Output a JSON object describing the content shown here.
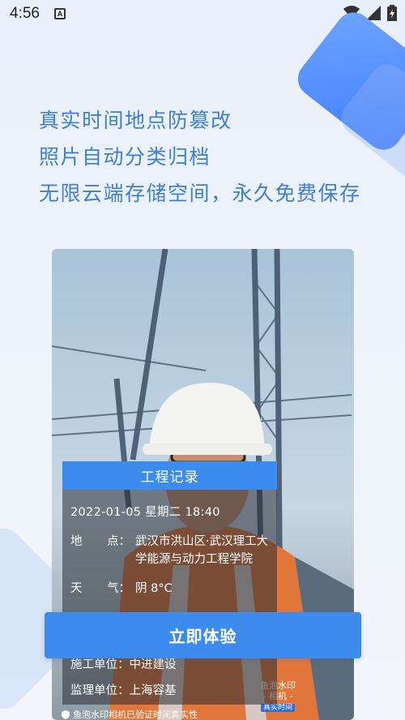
{
  "status_bar": {
    "time": "4:56",
    "app_icon_letter": "A"
  },
  "headline": {
    "line1": "真实时间地点防篡改",
    "line2": "照片自动分类归档",
    "line3": "无限云端存储空间，永久免费保存"
  },
  "record": {
    "title": "工程记录",
    "datetime": "2022-01-05 星期二 18:40",
    "location_label_a": "地",
    "location_label_b": "点：",
    "location_value": "武汉市洪山区·武汉理工大学能源与动力工程学院",
    "weather_label_a": "天",
    "weather_label_b": "气：",
    "weather_value": "阴 8°C",
    "construction_label": "施工单位：",
    "construction_value": "中进建设",
    "supervision_label": "监理单位：",
    "supervision_value": "上海容基"
  },
  "watermark": {
    "brand_line1": "鱼泡水印",
    "brand_line2": "- 相机 -",
    "badge": "真实时间"
  },
  "footer_text": "鱼泡水印相机已验证时间真实性",
  "cta": {
    "label": "立即体验"
  },
  "colors": {
    "accent": "#3d8bef",
    "headline": "#3f7fd6"
  }
}
